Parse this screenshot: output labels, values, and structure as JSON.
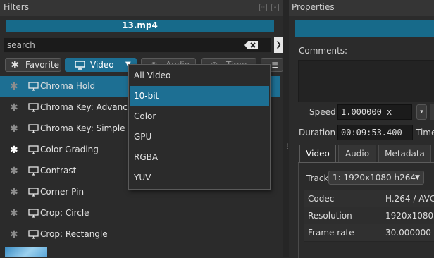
{
  "filters": {
    "title": "Filters",
    "clip_name": "13.mp4",
    "search": {
      "placeholder": "search"
    },
    "toolbar": {
      "favorite_label": "Favorite",
      "video_label": "Video",
      "audio_label": "Audio",
      "time_label": "Time"
    },
    "items": [
      {
        "label": "Chroma Hold",
        "favorite": false,
        "selected": true
      },
      {
        "label": "Chroma Key: Advanced",
        "favorite": false,
        "selected": false
      },
      {
        "label": "Chroma Key: Simple",
        "favorite": false,
        "selected": false
      },
      {
        "label": "Color Grading",
        "favorite": true,
        "selected": false
      },
      {
        "label": "Contrast",
        "favorite": false,
        "selected": false
      },
      {
        "label": "Corner Pin",
        "favorite": false,
        "selected": false
      },
      {
        "label": "Crop: Circle",
        "favorite": false,
        "selected": false
      },
      {
        "label": "Crop: Rectangle",
        "favorite": false,
        "selected": false
      }
    ]
  },
  "dropdown": {
    "items": [
      "All Video",
      "10-bit",
      "Color",
      "GPU",
      "RGBA",
      "YUV"
    ],
    "highlighted_index": 1
  },
  "properties": {
    "title": "Properties",
    "comments_label": "Comments:",
    "speed_label": "Speed",
    "speed_value": "1.000000 x",
    "duration_label": "Duration",
    "duration_value": "00:09:53.400",
    "time_label_partial": "Time",
    "tabs": [
      "Video",
      "Audio",
      "Metadata"
    ],
    "active_tab": "Video",
    "track_label": "Track",
    "track_value": "1: 1920x1080 h264",
    "info": [
      {
        "key": "Codec",
        "value": "H.264 / AVC"
      },
      {
        "key": "Resolution",
        "value": "1920x1080"
      },
      {
        "key": "Frame rate",
        "value": "30.000000"
      }
    ]
  },
  "colors": {
    "accent": "#1d6f93",
    "panel_bg": "#2b2b2b",
    "header_bg": "#353535"
  }
}
